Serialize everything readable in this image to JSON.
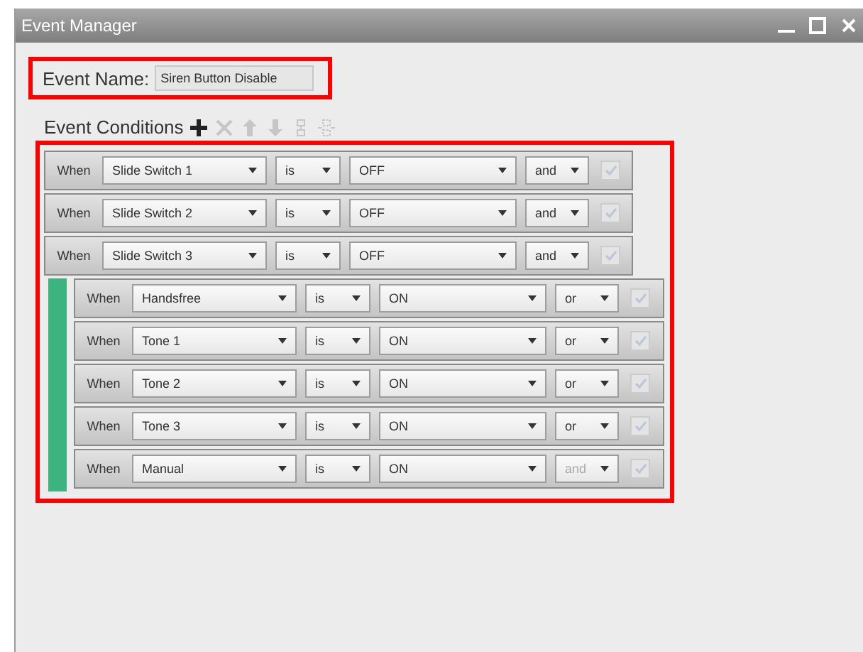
{
  "window": {
    "title": "Event Manager"
  },
  "event_name": {
    "label": "Event Name:",
    "value": "Siren Button Disable"
  },
  "conditions_header": {
    "label": "Event Conditions"
  },
  "toolbar": [
    {
      "kind": "add",
      "disabled": false
    },
    {
      "kind": "delete",
      "disabled": true
    },
    {
      "kind": "up",
      "disabled": true
    },
    {
      "kind": "down",
      "disabled": true
    },
    {
      "kind": "group",
      "disabled": true
    },
    {
      "kind": "ungroup",
      "disabled": true
    }
  ],
  "conditions": [
    {
      "kind": "row",
      "when": "When",
      "subject": "Slide Switch 1",
      "operator": "is",
      "value": "OFF",
      "conjunction": "and",
      "conjunction_disabled": false,
      "checked": true
    },
    {
      "kind": "row",
      "when": "When",
      "subject": "Slide Switch 2",
      "operator": "is",
      "value": "OFF",
      "conjunction": "and",
      "conjunction_disabled": false,
      "checked": true
    },
    {
      "kind": "row",
      "when": "When",
      "subject": "Slide Switch 3",
      "operator": "is",
      "value": "OFF",
      "conjunction": "and",
      "conjunction_disabled": false,
      "checked": true
    },
    {
      "kind": "group",
      "color": "#3db37f",
      "children": [
        {
          "kind": "row",
          "when": "When",
          "subject": "Handsfree",
          "operator": "is",
          "value": "ON",
          "conjunction": "or",
          "conjunction_disabled": false,
          "checked": true
        },
        {
          "kind": "row",
          "when": "When",
          "subject": "Tone 1",
          "operator": "is",
          "value": "ON",
          "conjunction": "or",
          "conjunction_disabled": false,
          "checked": true
        },
        {
          "kind": "row",
          "when": "When",
          "subject": "Tone 2",
          "operator": "is",
          "value": "ON",
          "conjunction": "or",
          "conjunction_disabled": false,
          "checked": true
        },
        {
          "kind": "row",
          "when": "When",
          "subject": "Tone 3",
          "operator": "is",
          "value": "ON",
          "conjunction": "or",
          "conjunction_disabled": false,
          "checked": true
        },
        {
          "kind": "row",
          "when": "When",
          "subject": "Manual",
          "operator": "is",
          "value": "ON",
          "conjunction": "and",
          "conjunction_disabled": true,
          "checked": true
        }
      ]
    }
  ]
}
